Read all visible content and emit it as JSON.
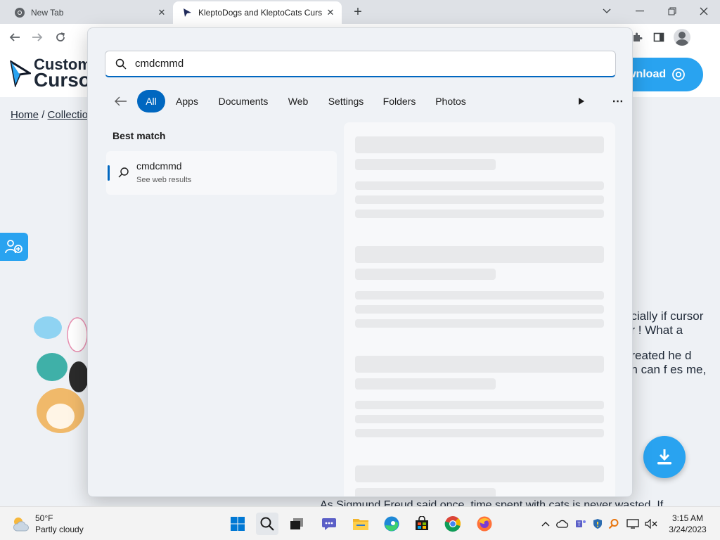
{
  "browser": {
    "tabs": [
      {
        "title": "New Tab",
        "favicon": "chrome-icon",
        "active": false
      },
      {
        "title": "KleptoDogs and KleptoCats Curs",
        "favicon": "cursor-logo-icon",
        "active": true
      }
    ],
    "new_tab_label": "+",
    "window_controls": [
      "chevron-down-icon",
      "minimize-icon",
      "restore-icon",
      "close-icon"
    ],
    "toolbar_icons": [
      "back-icon",
      "forward-icon",
      "reload-icon",
      "extensions-icon",
      "side-panel-icon",
      "profile-avatar"
    ]
  },
  "site": {
    "logo_line1": "Custom",
    "logo_line2": "Curso",
    "download_label": "wnload",
    "breadcrumb": {
      "home": "Home",
      "separator": "/",
      "collection": "Collection"
    },
    "article_paragraphs": [
      "specially if cursor your ! What a",
      "m created he d even can f es me,"
    ],
    "freud_line": "As Sigmund Freud said once, time spent with cats is never wasted. If",
    "accent_color": "#29a3f0"
  },
  "search": {
    "query": "cmdcmmd",
    "filters": [
      "All",
      "Apps",
      "Documents",
      "Web",
      "Settings",
      "Folders",
      "Photos"
    ],
    "active_filter": "All",
    "best_match_heading": "Best match",
    "result": {
      "title": "cmdcmmd",
      "subtitle": "See web results",
      "icon": "search-icon"
    },
    "accent_color": "#0067c0"
  },
  "taskbar": {
    "weather": {
      "temp": "50°F",
      "condition": "Partly cloudy"
    },
    "apps": [
      "start-icon",
      "search-icon",
      "task-view-icon",
      "teams-chat-icon",
      "file-explorer-icon",
      "edge-icon",
      "store-icon",
      "chrome-icon",
      "firefox-icon"
    ],
    "tray_icons": [
      "chevron-up-icon",
      "onedrive-icon",
      "teams-icon",
      "defender-icon",
      "search-tray-icon",
      "display-icon",
      "volume-muted-icon"
    ],
    "time": "3:15 AM",
    "date": "3/24/2023"
  }
}
